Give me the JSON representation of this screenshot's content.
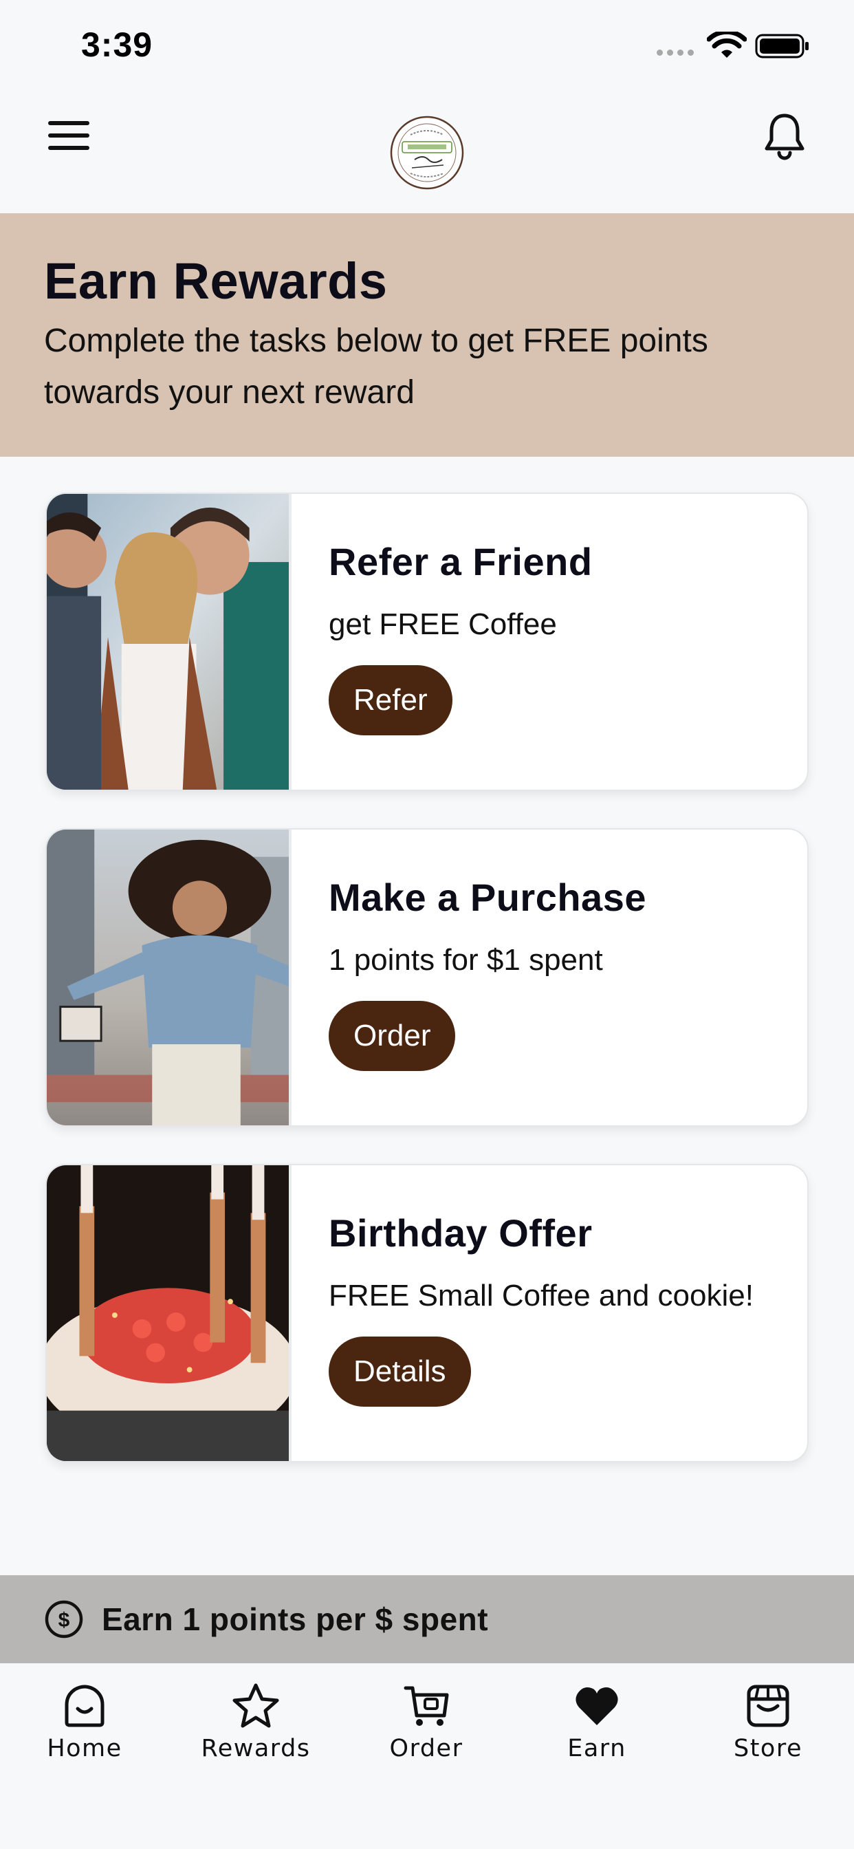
{
  "status_bar": {
    "time": "3:39"
  },
  "header": {
    "logo_alt": "Civic Center Cafe"
  },
  "banner": {
    "title": "Earn Rewards",
    "subtitle": "Complete the tasks below to get FREE points towards your next reward"
  },
  "cards": [
    {
      "title": "Refer a Friend",
      "description": "get FREE Coffee",
      "button": "Refer"
    },
    {
      "title": "Make a Purchase",
      "description": "1 points for $1 spent",
      "button": "Order"
    },
    {
      "title": "Birthday Offer",
      "description": "FREE Small Coffee and cookie!",
      "button": "Details"
    }
  ],
  "points_bar": {
    "text": "Earn 1 points per $ spent"
  },
  "tabs": [
    {
      "label": "Home",
      "icon": "home-icon"
    },
    {
      "label": "Rewards",
      "icon": "star-icon"
    },
    {
      "label": "Order",
      "icon": "cart-icon"
    },
    {
      "label": "Earn",
      "icon": "heart-icon",
      "active": true
    },
    {
      "label": "Store",
      "icon": "store-icon"
    }
  ],
  "colors": {
    "banner": "#d8c2b1",
    "button": "#4a2510",
    "points_bar": "#b7b6b5"
  }
}
